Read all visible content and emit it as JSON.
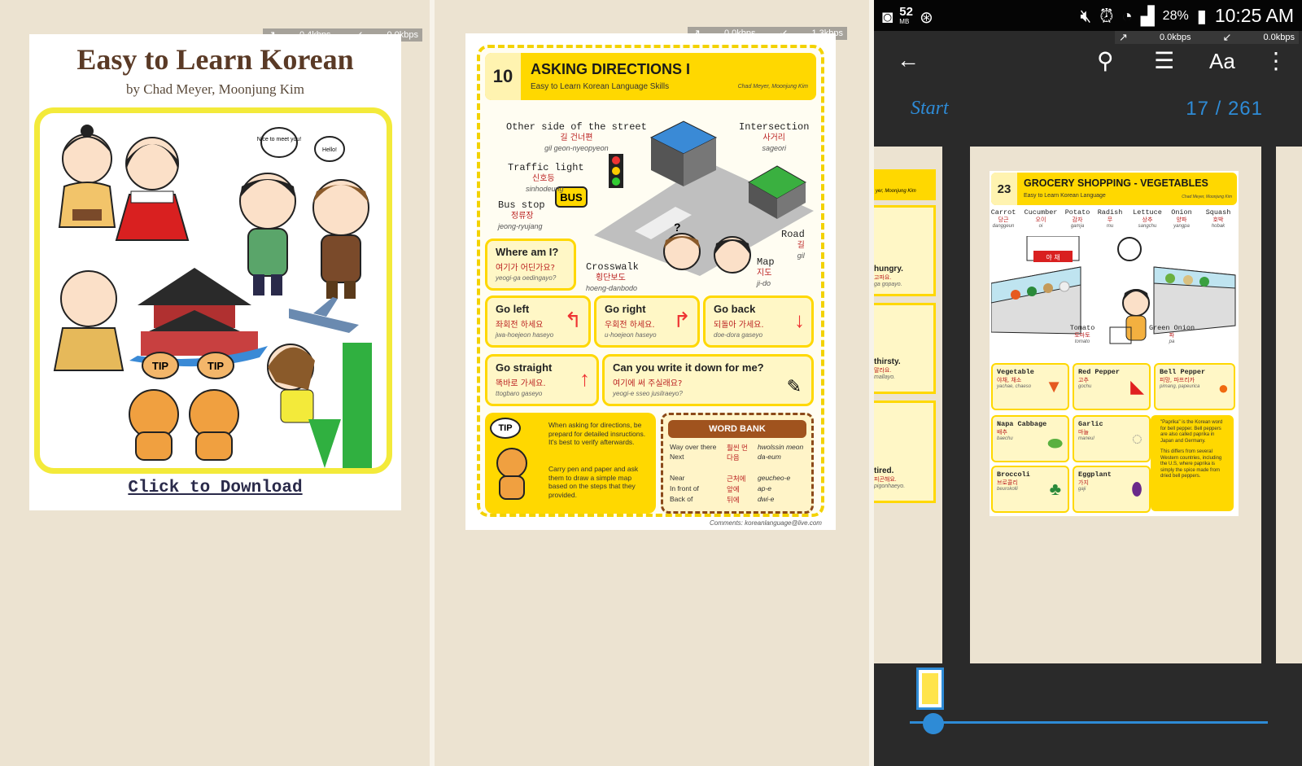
{
  "speed_meters": [
    {
      "up": "0.4kbps",
      "down": "0.0kbps"
    },
    {
      "up": "0.0kbps",
      "down": "1.3kbps"
    },
    {
      "up": "0.0kbps",
      "down": "0.0kbps"
    }
  ],
  "cover": {
    "title": "Easy to Learn Korean",
    "authors": "by Chad Meyer, Moonjung Kim",
    "download": "Click to Download",
    "bubble1": "Nice to meet you!",
    "bubble2": "Hello!",
    "tip1": "TIP",
    "tip2": "TIP"
  },
  "directions": {
    "number": "10",
    "title": "ASKING DIRECTIONS I",
    "subtitle": "Easy to Learn Korean Language Skills",
    "authors": "Chad Meyer, Moonjung Kim",
    "labels": [
      {
        "en": "Other side of the street",
        "ko": "길 건너편",
        "ro": "gil geon-nyeopyeon"
      },
      {
        "en": "Intersection",
        "ko": "사거리",
        "ro": "sageori"
      },
      {
        "en": "Traffic light",
        "ko": "신호등",
        "ro": "sinhodeung"
      },
      {
        "en": "Bus stop",
        "ko": "정류장",
        "ro": "jeong-ryujang"
      },
      {
        "en": "Road",
        "ko": "길",
        "ro": "gil"
      },
      {
        "en": "Crosswalk",
        "ko": "횡단보도",
        "ro": "hoeng-danbodo"
      },
      {
        "en": "Map",
        "ko": "지도",
        "ro": "ji-do"
      }
    ],
    "bus_sign": "BUS",
    "question_mark": "?",
    "where": {
      "en": "Where am I?",
      "ko": "여기가 어딘가요?",
      "ro": "yeogi-ga oedingayo?"
    },
    "phrases": [
      {
        "en": "Go left",
        "ko": "좌회전 하세요",
        "ro": "jwa-hoejeon haseyo"
      },
      {
        "en": "Go right",
        "ko": "우회전 하세요.",
        "ro": "u-hoejeon haseyo"
      },
      {
        "en": "Go back",
        "ko": "되돌아 가세요.",
        "ro": "doe-dora gaseyo"
      },
      {
        "en": "Go straight",
        "ko": "똑바로 가세요.",
        "ro": "ttogbaro gaseyo"
      }
    ],
    "write": {
      "en": "Can you write it down for me?",
      "ko": "여기에 써 주실래요?",
      "ro": "yeogi-e sseo jusilraeyo?"
    },
    "tip_label": "TIP",
    "tips": [
      "When asking for directions, be prepard for detailed insructions.  It's best to verify afterwards.",
      "Carry pen and paper and ask them to draw a simple map based on the steps that they provided."
    ],
    "word_bank_title": "WORD BANK",
    "word_bank": [
      {
        "en": "Way over there",
        "ko": "훨씬 먼",
        "ro": "hwolssin meon"
      },
      {
        "en": "Next",
        "ko": "다음",
        "ro": "da-eum"
      },
      {
        "en": "Near",
        "ko": "근처에",
        "ro": "geucheo-e"
      },
      {
        "en": "In front of",
        "ko": "앞에",
        "ro": "ap-e"
      },
      {
        "en": "Back of",
        "ko": "뒤에",
        "ro": "dwi-e"
      }
    ],
    "footnote": "Comments: koreanlanguage@live.com"
  },
  "status_bar": {
    "memory": "52",
    "memory_unit": "MB",
    "battery": "28%",
    "time": "10:25 AM"
  },
  "reader": {
    "start_label": "Start",
    "page_indicator": "17 / 261",
    "progress_fraction": 0.065,
    "icons": [
      "back-arrow-icon",
      "search-icon",
      "toc-list-icon",
      "font-size-icon",
      "more-vert-icon"
    ],
    "font_label": "Aa"
  },
  "prev_page": {
    "header_author": "yer, Moonjung Kim",
    "items": [
      {
        "en": "hungry.",
        "ko": "고파요.",
        "ro": "ga gopayo."
      },
      {
        "en": "thirsty.",
        "ko": "말라요.",
        "ro": "mallayo."
      },
      {
        "en": "tired.",
        "ko": "피곤해요.",
        "ro": "pigonhaeyo."
      }
    ]
  },
  "vegetables": {
    "number": "23",
    "title": "GROCERY SHOPPING - VEGETABLES",
    "subtitle": "Easy to Learn Korean Language",
    "authors": "Chad Meyer, Moonjung Kim",
    "sign": "야 채",
    "top_labels": [
      {
        "en": "Carrot",
        "ko": "당근",
        "ro": "danggeun"
      },
      {
        "en": "Cucumber",
        "ko": "오이",
        "ro": "oi"
      },
      {
        "en": "Potato",
        "ko": "감자",
        "ro": "gamja"
      },
      {
        "en": "Radish",
        "ko": "무",
        "ro": "mu"
      },
      {
        "en": "Lettuce",
        "ko": "상추",
        "ro": "sangchu"
      },
      {
        "en": "Onion",
        "ko": "양파",
        "ro": "yangpa"
      },
      {
        "en": "Squash",
        "ko": "호박",
        "ro": "hobak"
      }
    ],
    "tomato": {
      "en": "Tomato",
      "ko": "토마토",
      "ro": "tomato"
    },
    "green_onion": {
      "en": "Green Onion",
      "ko": "파",
      "ro": "pa"
    },
    "boxes": [
      {
        "en": "Vegetable",
        "ko": "야채, 채소",
        "ro": "yachae, chaeso"
      },
      {
        "en": "Red Pepper",
        "ko": "고추",
        "ro": "gochu"
      },
      {
        "en": "Bell Pepper",
        "ko": "피망, 파프리카",
        "ro": "pimang, papeurica"
      },
      {
        "en": "Napa Cabbage",
        "ko": "배추",
        "ro": "baechu"
      },
      {
        "en": "Garlic",
        "ko": "마늘",
        "ro": "maneul"
      },
      {
        "en": "Broccoli",
        "ko": "브로콜리",
        "ro": "beurokolli"
      },
      {
        "en": "Eggplant",
        "ko": "가지",
        "ro": "gaji"
      }
    ],
    "tips": [
      "\"Paprika\" is the Korean word for bell pepper. Bell peppers are also called paprika in Japan and Germany.",
      "This differs from several Western countries, including the U.S, where paprika is simply the spice made from dried bell peppers."
    ]
  },
  "colors": {
    "accent_blue": "#2e8bd6",
    "yellow": "#ffd800",
    "reader_bg": "#2a2a2a"
  }
}
